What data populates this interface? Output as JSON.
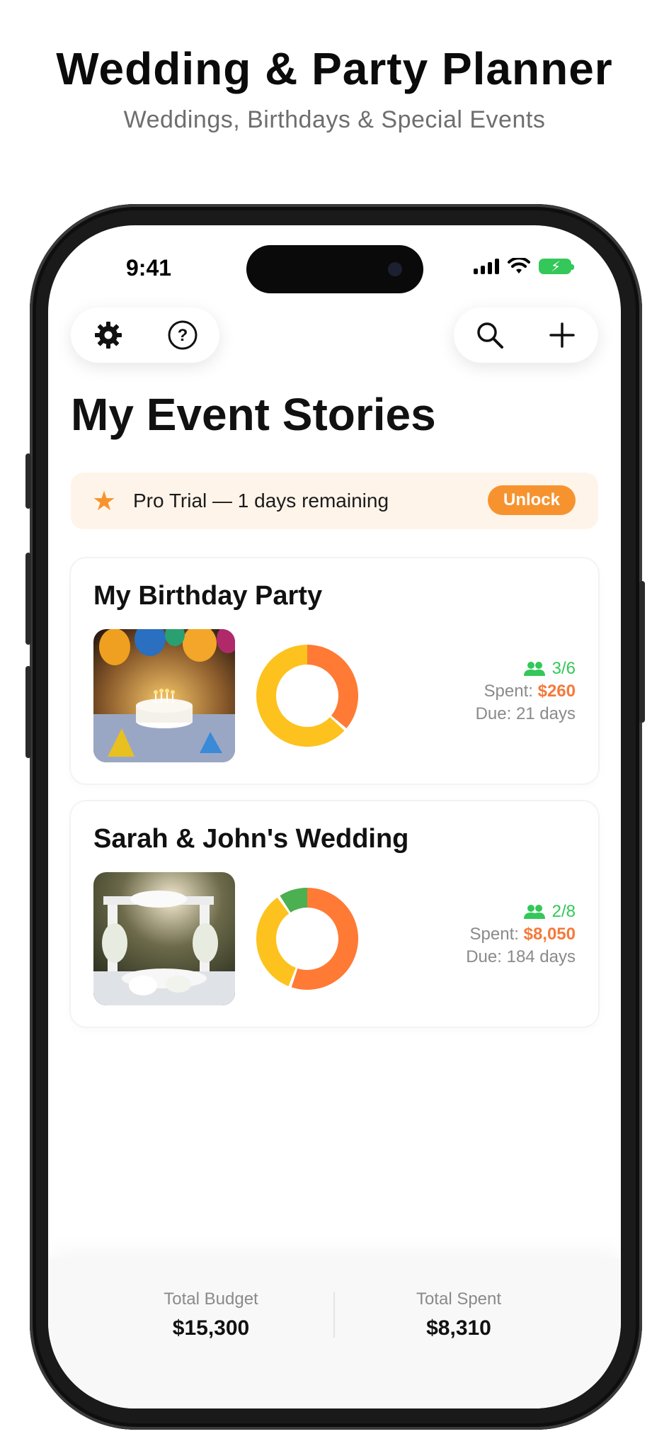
{
  "header": {
    "title": "Wedding & Party Planner",
    "subtitle": "Weddings, Birthdays & Special Events"
  },
  "status_bar": {
    "time": "9:41"
  },
  "toolbar": {
    "left_icons": [
      "gear-icon",
      "help-circle-icon"
    ],
    "right_icons": [
      "search-icon",
      "plus-icon"
    ]
  },
  "page": {
    "title": "My Event Stories"
  },
  "trial_banner": {
    "text": "Pro Trial — 1 days remaining",
    "button_label": "Unlock"
  },
  "events": [
    {
      "title": "My Birthday Party",
      "guests": "3/6",
      "spent_label": "Spent:",
      "spent_value": "$260",
      "due_label": "Due:",
      "due_value": "21 days",
      "photo": "birthday-cake-balloons-photo"
    },
    {
      "title": "Sarah & John's Wedding",
      "guests": "2/8",
      "spent_label": "Spent:",
      "spent_value": "$8,050",
      "due_label": "Due:",
      "due_value": "184 days",
      "photo": "wedding-arch-flowers-photo"
    }
  ],
  "footer": {
    "total_budget_label": "Total Budget",
    "total_budget_value": "$15,300",
    "total_spent_label": "Total Spent",
    "total_spent_value": "$8,310"
  },
  "colors": {
    "accent_orange": "#f7932f",
    "spent_orange": "#f47a3a",
    "chart_orange": "#ff7a35",
    "chart_yellow": "#fdc21e",
    "chart_green": "#4caf50",
    "guests_green": "#34c759",
    "banner_bg": "#fff4ea"
  }
}
